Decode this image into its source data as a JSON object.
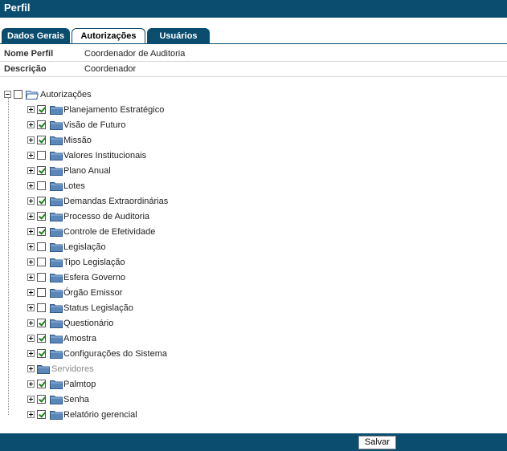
{
  "window": {
    "title": "Perfil"
  },
  "tabs": [
    {
      "label": "Dados Gerais",
      "active": false
    },
    {
      "label": "Autorizações",
      "active": true
    },
    {
      "label": "Usuários",
      "active": false
    }
  ],
  "profile": {
    "name_label": "Nome Perfil",
    "name_value": "Coordenador de Auditoria",
    "desc_label": "Descrição",
    "desc_value": "Coordenador"
  },
  "tree": {
    "root": {
      "label": "Autorizações",
      "checked": false,
      "expanded": true
    },
    "items": [
      {
        "label": "Planejamento Estratégico",
        "checked": true,
        "disabled": false
      },
      {
        "label": "Visão de Futuro",
        "checked": true,
        "disabled": false
      },
      {
        "label": "Missão",
        "checked": true,
        "disabled": false
      },
      {
        "label": "Valores Institucionais",
        "checked": false,
        "disabled": false
      },
      {
        "label": "Plano Anual",
        "checked": true,
        "disabled": false
      },
      {
        "label": "Lotes",
        "checked": false,
        "disabled": false
      },
      {
        "label": "Demandas Extraordinárias",
        "checked": true,
        "disabled": false
      },
      {
        "label": "Processo de Auditoria",
        "checked": true,
        "disabled": false
      },
      {
        "label": "Controle de Efetividade",
        "checked": true,
        "disabled": false
      },
      {
        "label": "Legislação",
        "checked": false,
        "disabled": false
      },
      {
        "label": "Tipo Legislação",
        "checked": false,
        "disabled": false
      },
      {
        "label": "Esfera Governo",
        "checked": false,
        "disabled": false
      },
      {
        "label": "Órgão Emissor",
        "checked": false,
        "disabled": false
      },
      {
        "label": "Status Legislação",
        "checked": false,
        "disabled": false
      },
      {
        "label": "Questionário",
        "checked": true,
        "disabled": false
      },
      {
        "label": "Amostra",
        "checked": true,
        "disabled": false
      },
      {
        "label": "Configurações do Sistema",
        "checked": true,
        "disabled": false
      },
      {
        "label": "Servidores",
        "checked": null,
        "disabled": true
      },
      {
        "label": "Palmtop",
        "checked": true,
        "disabled": false
      },
      {
        "label": "Senha",
        "checked": true,
        "disabled": false
      },
      {
        "label": "Relatório gerencial",
        "checked": true,
        "disabled": false
      }
    ]
  },
  "footer": {
    "save_label": "Salvar"
  },
  "colors": {
    "header": "#0a4d6e",
    "folder": "#5b86b8",
    "check": "#1a7f1a"
  }
}
